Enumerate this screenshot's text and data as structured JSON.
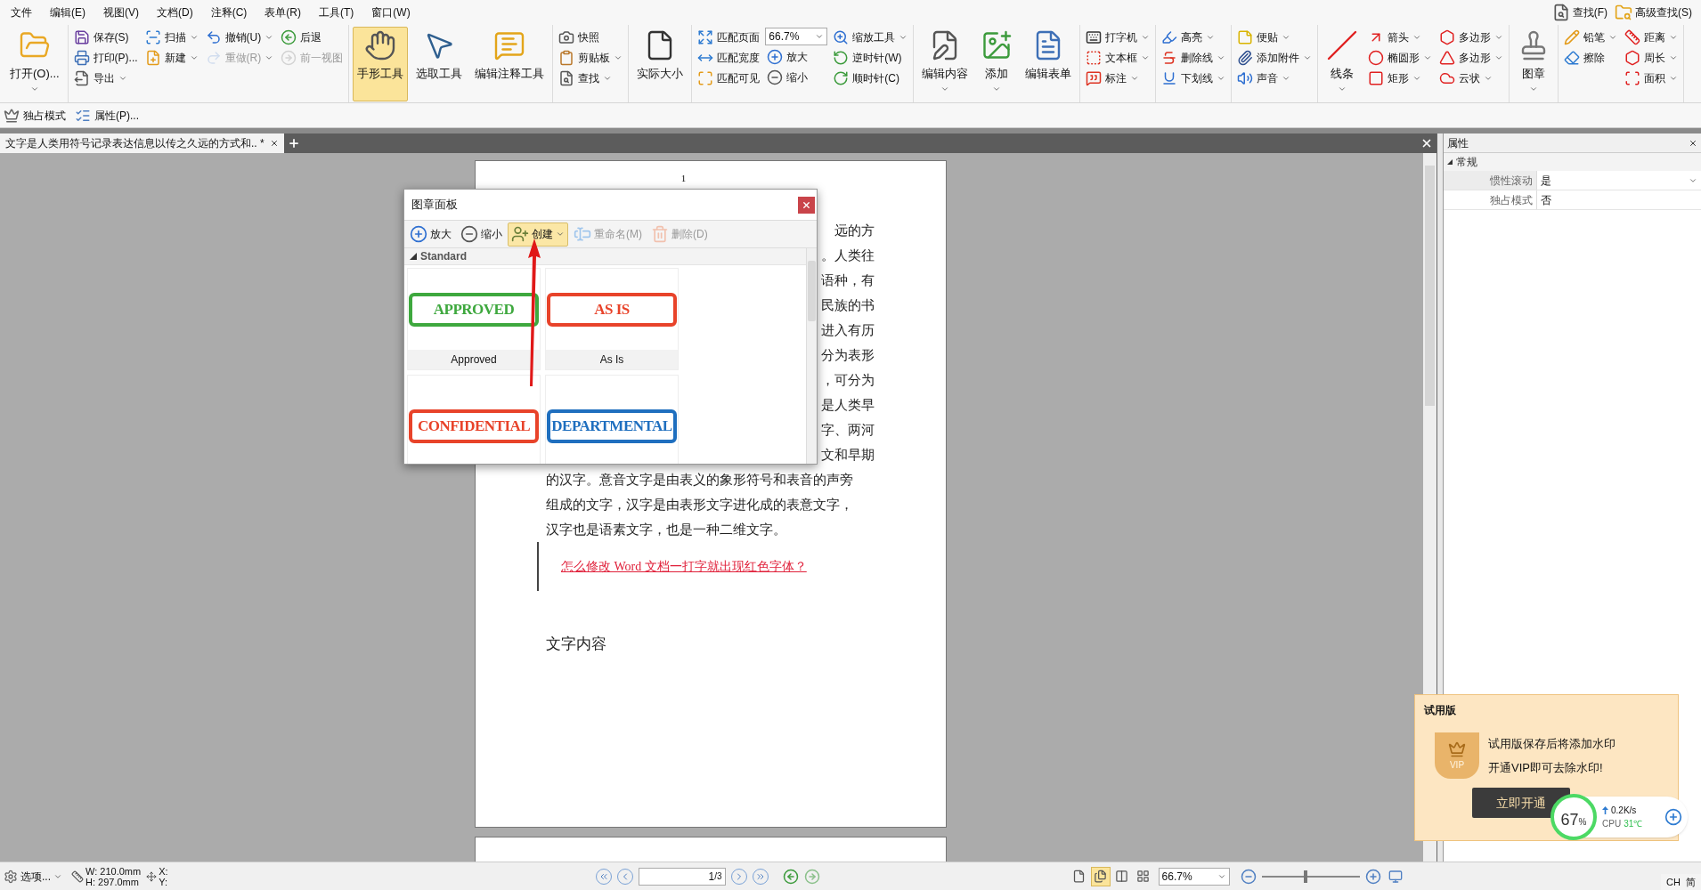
{
  "menu": [
    {
      "label": "文件"
    },
    {
      "label": "编辑(E)"
    },
    {
      "label": "视图(V)"
    },
    {
      "label": "文档(D)"
    },
    {
      "label": "注释(C)"
    },
    {
      "label": "表单(R)"
    },
    {
      "label": "工具(T)"
    },
    {
      "label": "窗口(W)"
    }
  ],
  "quick_search": [
    {
      "label": "查找(F)"
    },
    {
      "label": "高级查找(S)"
    }
  ],
  "ribbon": [
    {
      "columns": [
        [
          {
            "kind": "large",
            "label": "打开(O)...",
            "dropdown": true
          }
        ]
      ]
    },
    {
      "columns": [
        [
          {
            "kind": "small",
            "label": "保存(S)"
          },
          {
            "kind": "small",
            "label": "打印(P)..."
          },
          {
            "kind": "small",
            "label": "导出",
            "dropdown": true
          }
        ],
        [
          {
            "kind": "small",
            "label": "扫描",
            "dropdown": true
          },
          {
            "kind": "small",
            "label": "新建",
            "dropdown": true
          }
        ],
        [
          {
            "kind": "small",
            "label": "撤销(U)",
            "dropdown": true,
            "disabled": false
          },
          {
            "kind": "small",
            "label": "重做(R)",
            "dropdown": true,
            "disabled": true
          }
        ],
        [
          {
            "kind": "small",
            "label": "后退",
            "disabled": false
          },
          {
            "kind": "small",
            "label": "前一视图",
            "disabled": true
          }
        ]
      ]
    },
    {
      "columns": [
        [
          {
            "kind": "large",
            "label": "手形工具",
            "selected": true
          }
        ],
        [
          {
            "kind": "large",
            "label": "选取工具",
            "selected": false
          }
        ],
        [
          {
            "kind": "large",
            "label": "编辑注释工具",
            "selected": false
          }
        ]
      ]
    },
    {
      "columns": [
        [
          {
            "kind": "small",
            "label": "快照"
          },
          {
            "kind": "small",
            "label": "剪贴板",
            "dropdown": true
          },
          {
            "kind": "small",
            "label": "查找",
            "dropdown": true
          }
        ]
      ]
    },
    {
      "columns": [
        [
          {
            "kind": "large",
            "label": "实际大小"
          }
        ]
      ]
    },
    {
      "columns": [
        [
          {
            "kind": "small",
            "label": "匹配页面"
          },
          {
            "kind": "small",
            "label": "匹配宽度"
          },
          {
            "kind": "small",
            "label": "匹配可见"
          }
        ],
        [
          {
            "kind": "field",
            "value": "66.7%"
          },
          {
            "kind": "small",
            "label": "放大"
          },
          {
            "kind": "small",
            "label": "缩小"
          }
        ],
        [
          {
            "kind": "small",
            "label": "缩放工具",
            "dropdown": true
          },
          {
            "kind": "small",
            "label": "逆时针(W)"
          },
          {
            "kind": "small",
            "label": "顺时针(C)"
          }
        ]
      ]
    },
    {
      "columns": [
        [
          {
            "kind": "large",
            "label": "编辑内容",
            "dropdown": true
          }
        ],
        [
          {
            "kind": "large",
            "label": "添加",
            "dropdown": true
          }
        ],
        [
          {
            "kind": "large",
            "label": "编辑表单"
          }
        ]
      ]
    },
    {
      "columns": [
        [
          {
            "kind": "small",
            "label": "打字机",
            "dropdown": true
          },
          {
            "kind": "small",
            "label": "文本框",
            "dropdown": true
          },
          {
            "kind": "small",
            "label": "标注",
            "dropdown": true
          }
        ]
      ]
    },
    {
      "columns": [
        [
          {
            "kind": "small",
            "label": "高亮",
            "dropdown": true
          },
          {
            "kind": "small",
            "label": "删除线",
            "dropdown": true
          },
          {
            "kind": "small",
            "label": "下划线",
            "dropdown": true
          }
        ]
      ]
    },
    {
      "columns": [
        [
          {
            "kind": "small",
            "label": "便贴",
            "dropdown": true
          },
          {
            "kind": "small",
            "label": "添加附件",
            "dropdown": true
          },
          {
            "kind": "small",
            "label": "声音",
            "dropdown": true
          }
        ]
      ]
    },
    {
      "columns": [
        [
          {
            "kind": "large",
            "label": "线条",
            "dropdown": true
          }
        ],
        [
          {
            "kind": "small",
            "label": "箭头",
            "dropdown": true
          },
          {
            "kind": "small",
            "label": "椭圆形",
            "dropdown": true
          },
          {
            "kind": "small",
            "label": "矩形",
            "dropdown": true
          }
        ],
        [
          {
            "kind": "small",
            "label": "多边形",
            "dropdown": true
          },
          {
            "kind": "small",
            "label": "多边形",
            "dropdown": true
          },
          {
            "kind": "small",
            "label": "云状",
            "dropdown": true
          }
        ]
      ]
    },
    {
      "columns": [
        [
          {
            "kind": "large",
            "label": "图章",
            "dropdown": true
          }
        ]
      ]
    },
    {
      "columns": [
        [
          {
            "kind": "small",
            "label": "铅笔",
            "dropdown": true
          },
          {
            "kind": "small",
            "label": "擦除"
          }
        ],
        [
          {
            "kind": "small",
            "label": "距离",
            "dropdown": true
          },
          {
            "kind": "small",
            "label": "周长",
            "dropdown": true
          },
          {
            "kind": "small",
            "label": "面积",
            "dropdown": true
          }
        ]
      ]
    }
  ],
  "toolbar2": [
    {
      "label": "独占模式"
    },
    {
      "label": "属性(P)..."
    }
  ],
  "tabs": [
    {
      "label": "文字是人类用符号记录表达信息以传之久远的方式和.. *",
      "selected": true
    }
  ],
  "document": {
    "page_number": "1",
    "partial_lines": [
      "远的方",
      "。人类往",
      "语种，有",
      "民族的书",
      "进入有历",
      "分为表形",
      "，可分为",
      "是人类早",
      "字、两河",
      "文和早期"
    ],
    "lines": [
      "的汉字。意音文字是由表义的象形符号和表音的声旁",
      "组成的文字，汉字是由表形文字进化成的表意文字，",
      "汉字也是语素文字，也是一种二维文字。"
    ],
    "link": "怎么修改 Word 文档一打字就出现红色字体？",
    "heading": "文字内容"
  },
  "stamp_panel": {
    "title": "图章面板",
    "buttons": [
      {
        "label": "放大",
        "disabled": false,
        "selected": false
      },
      {
        "label": "缩小",
        "disabled": false,
        "selected": false
      },
      {
        "label": "创建",
        "disabled": false,
        "selected": true,
        "dropdown": true
      },
      {
        "label": "重命名(M)",
        "disabled": true,
        "selected": false
      },
      {
        "label": "删除(D)",
        "disabled": true,
        "selected": false
      }
    ],
    "category": {
      "label": "Standard",
      "expanded": true
    },
    "stamps": [
      {
        "text": "APPROVED",
        "label": "Approved",
        "color": "#3ea83e"
      },
      {
        "text": "AS IS",
        "label": "As Is",
        "color": "#e8432a"
      },
      {
        "text": "CONFIDENTIAL",
        "color": "#e8432a"
      },
      {
        "text": "DEPARTMENTAL",
        "color": "#1f6fbf"
      }
    ]
  },
  "properties": {
    "title": "属性",
    "section": {
      "label": "常规",
      "expanded": true
    },
    "rows": [
      {
        "name": "惯性滚动",
        "value": "是",
        "dropdown": true
      },
      {
        "name": "独占模式",
        "value": "否",
        "dropdown": false
      }
    ]
  },
  "trial_popup": {
    "title": "试用版",
    "lines": [
      "试用版保存后将添加水印",
      "开通VIP即可去除水印!"
    ],
    "button": "立即开通",
    "badge": "VIP"
  },
  "monitor": {
    "percent": "67",
    "percent_sign": "%",
    "speed": "0.2K/s",
    "cpu_label": "CPU",
    "temperature": "31℃"
  },
  "status_bar": {
    "options": "选项...",
    "width": "W: 210.0mm",
    "height": "H: 297.0mm",
    "x": "X:",
    "y": "Y:",
    "page": "1",
    "page_total": "/3",
    "zoom": "66.7%",
    "zoom_slider": {
      "level": 0.45
    },
    "layouts": [
      {
        "selected": false
      },
      {
        "selected": true
      },
      {
        "selected": false
      },
      {
        "selected": false
      }
    ]
  },
  "ime": {
    "lang": "CH",
    "mode": "简"
  }
}
